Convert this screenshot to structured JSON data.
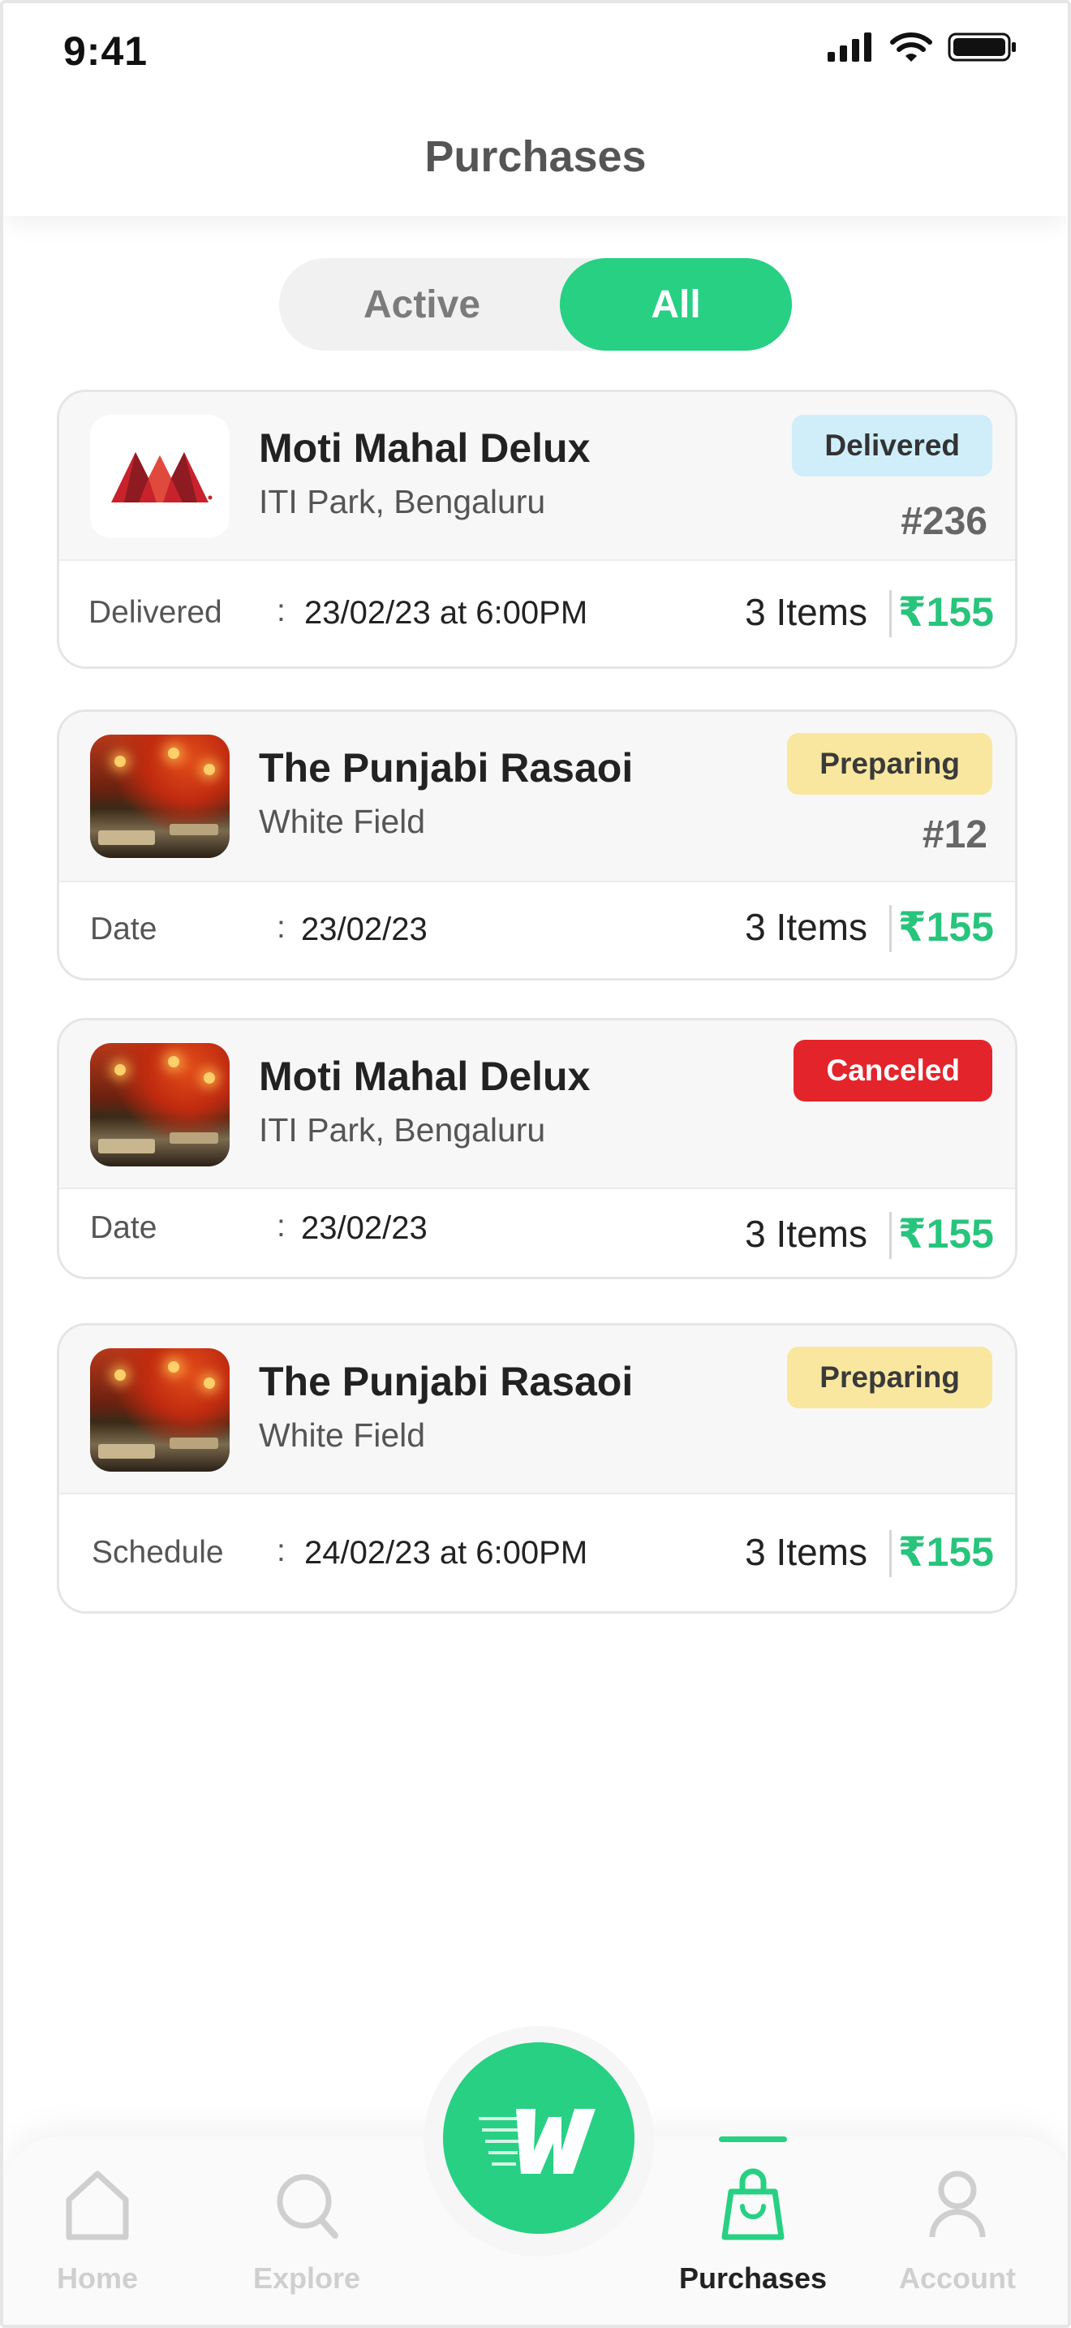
{
  "status_bar": {
    "time": "9:41"
  },
  "header": {
    "title": "Purchases"
  },
  "tabs": {
    "active_label": "Active",
    "all_label": "All",
    "selected": "All"
  },
  "orders": [
    {
      "name": "Moti Mahal Delux",
      "location": "ITI Park, Bengaluru",
      "status": "Delivered",
      "order_no": "#236",
      "detail_label": "Delivered",
      "detail_value": "23/02/23 at 6:00PM",
      "items": "3 Items",
      "price": "₹155",
      "thumb": "moti-mahal-logo"
    },
    {
      "name": "The Punjabi Rasaoi",
      "location": "White Field",
      "status": "Preparing",
      "order_no": "#12",
      "detail_label": "Date",
      "detail_value": "23/02/23",
      "items": "3 Items",
      "price": "₹155",
      "thumb": "restaurant-photo"
    },
    {
      "name": "Moti Mahal Delux",
      "location": "ITI Park, Bengaluru",
      "status": "Canceled",
      "detail_label": "Date",
      "detail_value": "23/02/23",
      "items": "3 Items",
      "price": "₹155",
      "thumb": "restaurant-photo"
    },
    {
      "name": "The Punjabi Rasaoi",
      "location": "White Field",
      "status": "Preparing",
      "detail_label": "Schedule",
      "detail_value": "24/02/23 at 6:00PM",
      "items": "3 Items",
      "price": "₹155",
      "thumb": "restaurant-photo"
    }
  ],
  "colon": ":",
  "bottom_nav": {
    "items": [
      {
        "label": "Home",
        "icon": "home-icon",
        "active": false
      },
      {
        "label": "Explore",
        "icon": "search-icon",
        "active": false
      },
      {
        "label": "Purchases",
        "icon": "shopping-bag-icon",
        "active": true
      },
      {
        "label": "Account",
        "icon": "user-icon",
        "active": false
      }
    ],
    "fab_icon": "w-logo-icon"
  },
  "colors": {
    "accent_green": "#27d083",
    "price_green": "#27c47c",
    "delivered_badge": "#cfeefa",
    "preparing_badge": "#f9e7a0",
    "canceled_badge": "#e3242b"
  }
}
